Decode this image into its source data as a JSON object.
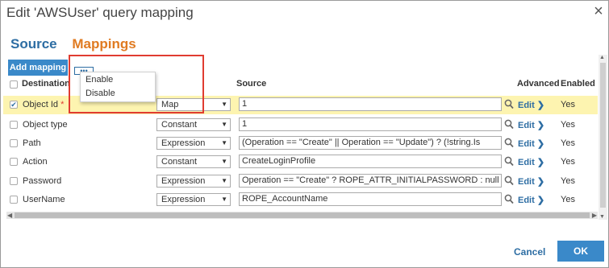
{
  "dialog": {
    "title": "Edit 'AWSUser' query mapping",
    "close": "×"
  },
  "tabs": [
    {
      "label": "Source"
    },
    {
      "label": "Mappings"
    }
  ],
  "toolbar": {
    "add_mapping": "Add mapping",
    "mini_dropdown": "•••"
  },
  "popup": {
    "items": [
      "Enable",
      "Disable"
    ]
  },
  "columns": {
    "destination": "Destination",
    "source": "Source",
    "advanced": "Advanced",
    "enabled": "Enabled"
  },
  "rows": [
    {
      "destination": "Object Id",
      "required": "*",
      "type": "Map",
      "source": "1",
      "edit": "Edit ❯",
      "enabled": "Yes",
      "checked": "✔",
      "selected": true
    },
    {
      "destination": "Object type",
      "required": "",
      "type": "Constant",
      "source": "1",
      "edit": "Edit ❯",
      "enabled": "Yes",
      "checked": "",
      "selected": false
    },
    {
      "destination": "Path",
      "required": "",
      "type": "Expression",
      "source": "(Operation == \"Create\" || Operation == \"Update\") ? (!string.Is",
      "edit": "Edit ❯",
      "enabled": "Yes",
      "checked": "",
      "selected": false
    },
    {
      "destination": "Action",
      "required": "",
      "type": "Constant",
      "source": "CreateLoginProfile",
      "edit": "Edit ❯",
      "enabled": "Yes",
      "checked": "",
      "selected": false
    },
    {
      "destination": "Password",
      "required": "",
      "type": "Expression",
      "source": "Operation == \"Create\" ? ROPE_ATTR_INITIALPASSWORD : null",
      "edit": "Edit ❯",
      "enabled": "Yes",
      "checked": "",
      "selected": false
    },
    {
      "destination": "UserName",
      "required": "",
      "type": "Expression",
      "source": "ROPE_AccountName",
      "edit": "Edit ❯",
      "enabled": "Yes",
      "checked": "",
      "selected": false
    }
  ],
  "footer": {
    "cancel": "Cancel",
    "ok": "OK"
  },
  "colors": {
    "accent_blue": "#3a89c9",
    "tab_orange": "#e07b22",
    "selected_row": "#fdf4b0",
    "highlight_red": "#e03c31"
  }
}
